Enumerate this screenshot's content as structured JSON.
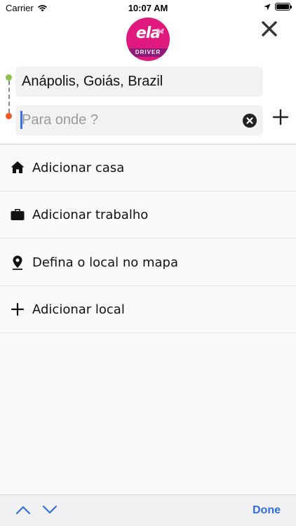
{
  "status_bar": {
    "carrier": "Carrier",
    "time": "10:07 AM"
  },
  "header": {
    "logo_text": "ela",
    "logo_band": "DRIVER",
    "close_icon": "close-icon"
  },
  "route": {
    "origin_value": "Anápolis, Goiás, Brazil",
    "destination_placeholder": "Para onde ?",
    "add_stop_icon": "plus-icon"
  },
  "list": {
    "items": [
      {
        "label": "Adicionar casa",
        "icon": "home-icon"
      },
      {
        "label": "Adicionar trabalho",
        "icon": "briefcase-icon"
      },
      {
        "label": "Defina o local no mapa",
        "icon": "location-pin-icon"
      },
      {
        "label": "Adicionar local",
        "icon": "plus-icon"
      }
    ]
  },
  "keyboard_toolbar": {
    "done_label": "Done"
  },
  "colors": {
    "brand": "#e0197e",
    "accent": "#2f6fdd",
    "origin_dot": "#8bc34a",
    "destination_dot": "#f05a22"
  }
}
